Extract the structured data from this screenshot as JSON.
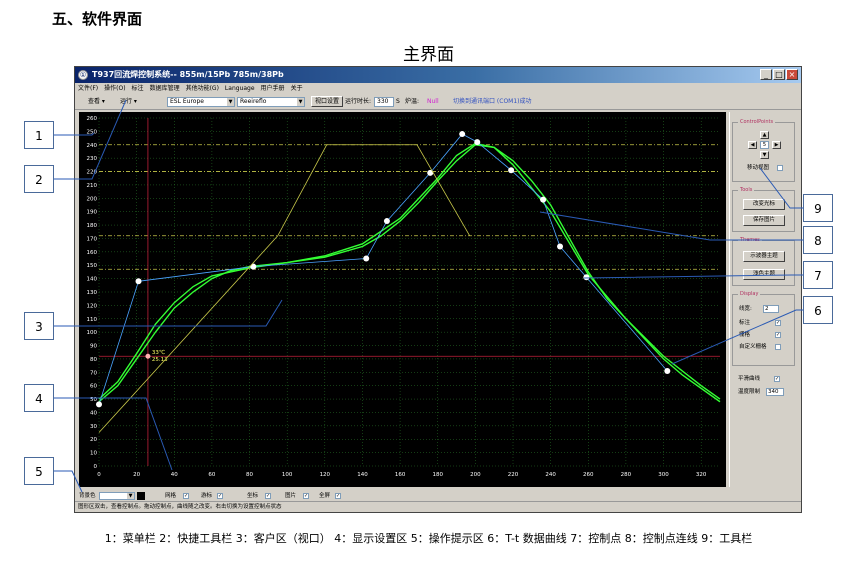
{
  "heading": "五、软件界面",
  "subtitle": "主界面",
  "window": {
    "title": "T937回流焊控制系统-- 855m/15Pb 785m/38Pb",
    "controls": [
      "_",
      "□",
      "×"
    ]
  },
  "menu": [
    "文件(F)",
    "操作(O)",
    "标注",
    "数据库管理",
    "其他功能(G)",
    "Language",
    "用户手册",
    "关于"
  ],
  "toolbar": {
    "view_label": "查看 ▾",
    "run_label": "运行 ▾",
    "profile_select": "ESL Europe",
    "mode_select": "Reeireflo",
    "window_settings_label": "视口设置",
    "runtime_label": "运行时长:",
    "runtime_value": "330",
    "runtime_unit": "S",
    "furnace_label": "炉温:",
    "furnace_value": "Null",
    "port_status": "切换到通讯端口 (COM1)成功"
  },
  "side_panel": {
    "control_points_title": "ControlPoints",
    "step_value": "5",
    "move_view_label": "移动视图",
    "tools_title": "Tools",
    "change_cursor_label": "改变光标",
    "save_image_label": "保存图片",
    "themes_title": "Themes",
    "default_theme_label": "示波器主题",
    "light_theme_label": "浅色主题",
    "display_title": "Display",
    "line_width_label": "线宽:",
    "line_width_value": "2",
    "annotation_label": "标注",
    "grid_label": "栅格",
    "custom_grid_label": "自定义栅格",
    "smooth_curve_label": "平滑曲线",
    "temp_limit_label": "温度限制",
    "temp_limit_value": "340"
  },
  "bottom_bar": {
    "background_color_label": "背景色",
    "grid_label": "网格",
    "grating_label": "游标",
    "coords_label": "坐标",
    "image_label": "图片",
    "fullscreen_label": "全屏"
  },
  "status_text": "图形区双击，查看控制点。拖动控制点，曲线随之改变。右击切换为设置控制点状态",
  "callouts": [
    "1",
    "2",
    "3",
    "4",
    "5",
    "6",
    "7",
    "8",
    "9"
  ],
  "caption": "1：菜单栏 2：快捷工具栏 3：客户区（视口） 4：显示设置区 5：操作提示区 6：T-t 数据曲线 7：控制点 8：控制点连线 9：工具栏",
  "cursor_readout": {
    "line1": "33℃",
    "line2": "25.13"
  },
  "colors": {
    "chart_bg": "#000000",
    "grid": "#2a7a2a",
    "curve": "#33ff33",
    "control_line": "#4aa3ff",
    "control_point": "#ffffff",
    "limit_line": "#c8c84a",
    "cursor_line": "#c0203a",
    "callout_border": "#4a6a9a",
    "callout_line": "#2a5ab4"
  },
  "chart_data": {
    "type": "line",
    "xlim": [
      0,
      330
    ],
    "ylim": [
      0,
      260
    ],
    "x_ticks": [
      0,
      20,
      40,
      60,
      80,
      100,
      120,
      140,
      160,
      180,
      200,
      220,
      240,
      260,
      280,
      300,
      320
    ],
    "y_ticks": [
      0,
      10,
      20,
      30,
      40,
      50,
      60,
      70,
      80,
      90,
      100,
      110,
      120,
      130,
      140,
      150,
      160,
      170,
      180,
      190,
      200,
      210,
      220,
      230,
      240,
      250,
      260
    ],
    "series": [
      {
        "role": "curve",
        "x": [
          0,
          10,
          20,
          30,
          40,
          50,
          60,
          70,
          80,
          100,
          120,
          140,
          150,
          160,
          170,
          180,
          190,
          200,
          210,
          220,
          230,
          240,
          250,
          260,
          270,
          280,
          290,
          300,
          310,
          330
        ],
        "y": [
          48,
          60,
          80,
          100,
          118,
          130,
          140,
          146,
          149,
          152,
          156,
          164,
          172,
          183,
          197,
          213,
          228,
          240,
          238,
          228,
          213,
          195,
          170,
          145,
          125,
          110,
          95,
          80,
          68,
          48
        ]
      },
      {
        "role": "curve",
        "x": [
          0,
          10,
          20,
          30,
          40,
          50,
          60,
          80,
          100,
          120,
          140,
          160,
          180,
          190,
          200,
          210,
          220,
          240,
          260,
          280,
          300,
          320,
          330
        ],
        "y": [
          50,
          63,
          84,
          106,
          122,
          134,
          142,
          148,
          152,
          157,
          166,
          185,
          215,
          232,
          241,
          238,
          225,
          190,
          143,
          110,
          82,
          60,
          50
        ]
      },
      {
        "role": "control_points",
        "x": [
          0,
          21,
          82,
          142,
          153,
          176,
          193,
          201,
          219,
          236,
          245,
          259,
          302
        ],
        "y": [
          46,
          138,
          149,
          155,
          183,
          219,
          248,
          242,
          221,
          199,
          164,
          141,
          71
        ]
      },
      {
        "role": "limit_profile",
        "x": [
          0,
          95,
          121,
          169,
          197
        ],
        "y": [
          25,
          172,
          240,
          240,
          172
        ]
      }
    ],
    "reference_lines_y": [
      240,
      220,
      172,
      147
    ],
    "cursor": {
      "x": 26,
      "y": 82
    }
  }
}
